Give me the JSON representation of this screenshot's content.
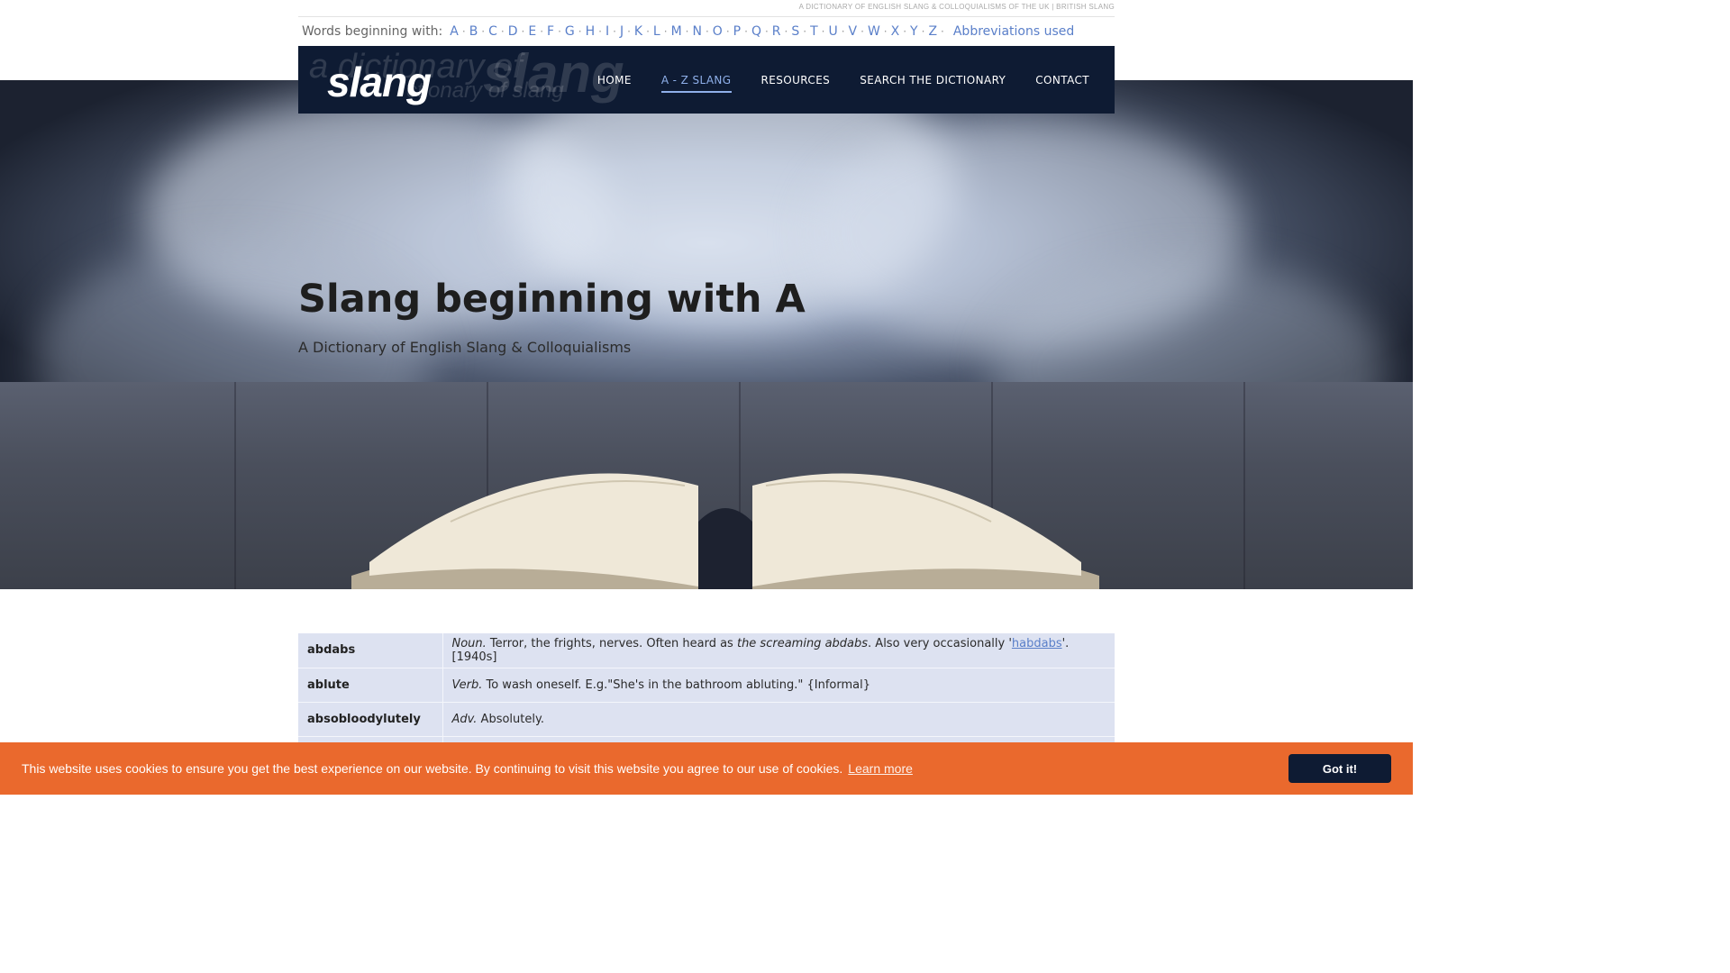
{
  "tagline": "A DICTIONARY OF ENGLISH SLANG & COLLOQUIALISMS OF THE UK | BRITISH SLANG",
  "alphabet": {
    "label": "Words beginning with:",
    "letters": [
      "A",
      "B",
      "C",
      "D",
      "E",
      "F",
      "G",
      "H",
      "I",
      "J",
      "K",
      "L",
      "M",
      "N",
      "O",
      "P",
      "Q",
      "R",
      "S",
      "T",
      "U",
      "V",
      "W",
      "X",
      "Y",
      "Z"
    ],
    "separator": "·",
    "abbreviations_link": "Abbreviations used"
  },
  "nav": {
    "logo": "slang",
    "logo_ghost": "a dictionary of slang",
    "items": [
      {
        "label": "HOME"
      },
      {
        "label": "A - Z SLANG"
      },
      {
        "label": "RESOURCES"
      },
      {
        "label": "SEARCH THE DICTIONARY"
      },
      {
        "label": "CONTACT"
      }
    ]
  },
  "hero": {
    "title": "Slang beginning with A",
    "subtitle": "A Dictionary of English Slang & Colloquialisms"
  },
  "entries": [
    {
      "word": "abdabs",
      "pos": "Noun.",
      "def1": " Terror, the frights, nerves. Often heard as ",
      "ital": "the screaming abdabs",
      "def2": ". Also very occasionally '",
      "link": "habdabs",
      "def3": "'. [1940s]"
    },
    {
      "word": "ablute",
      "pos": "Verb.",
      "def1": " To wash oneself. E.g.\"She's in the bathroom abluting.\" {Informal}"
    },
    {
      "word": "absobloodylutely",
      "pos": "Adv.",
      "def1": " Absolutely."
    }
  ],
  "cookie": {
    "message": "This website uses cookies to ensure you get the best experience on our website. By continuing to visit this website you agree to our use of cookies.",
    "learn_more": "Learn more",
    "button": "Got it!"
  },
  "colors": {
    "nav_bg": "#0e1b33",
    "link": "#5a7fc9",
    "active_nav": "#8fb0ea",
    "table_row": "#dde2f1",
    "cookie_bg": "#ea692d"
  }
}
